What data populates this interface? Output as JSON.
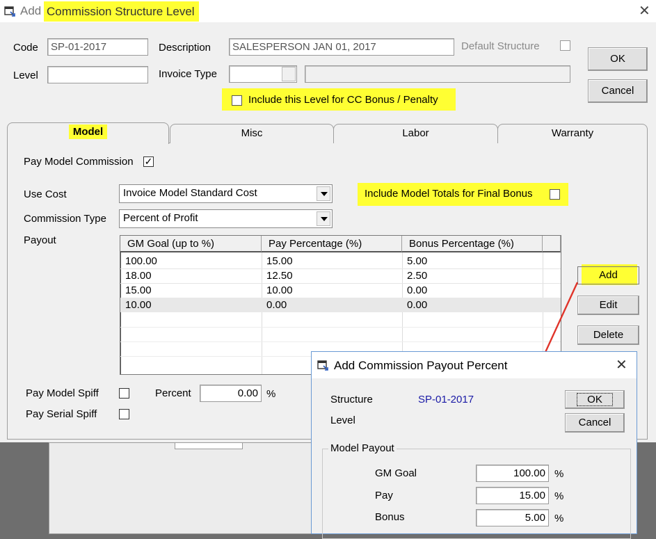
{
  "main_window": {
    "title_prefix": "Add",
    "title": "Commission Structure Level",
    "close_glyph": "✕"
  },
  "header": {
    "code_label": "Code",
    "code_value": "SP-01-2017",
    "description_label": "Description",
    "description_value": "SALESPERSON JAN 01, 2017",
    "default_structure_label": "Default Structure",
    "level_label": "Level",
    "level_value": "",
    "invoice_type_label": "Invoice Type",
    "invoice_type_value": "",
    "invoice_type_desc": "",
    "include_cc_label": "Include this Level for CC Bonus / Penalty",
    "ok_label": "OK",
    "cancel_label": "Cancel"
  },
  "tabs": [
    {
      "label": "Model",
      "active": true
    },
    {
      "label": "Misc",
      "active": false
    },
    {
      "label": "Labor",
      "active": false
    },
    {
      "label": "Warranty",
      "active": false
    }
  ],
  "model_tab": {
    "pay_model_commission_label": "Pay Model Commission",
    "pay_model_commission_checked": "✓",
    "use_cost_label": "Use Cost",
    "use_cost_value": "Invoice Model Standard Cost",
    "include_totals_label": "Include Model Totals for Final Bonus",
    "commission_type_label": "Commission Type",
    "commission_type_value": "Percent of Profit",
    "payout_label": "Payout",
    "payout_columns": [
      "GM Goal (up to %)",
      "Pay Percentage (%)",
      "Bonus Percentage (%)"
    ],
    "payout_rows": [
      [
        "100.00",
        "15.00",
        "5.00"
      ],
      [
        "18.00",
        "12.50",
        "2.50"
      ],
      [
        "15.00",
        "10.00",
        "0.00"
      ],
      [
        "10.00",
        "0.00",
        "0.00"
      ]
    ],
    "add_label": "Add",
    "edit_label": "Edit",
    "delete_label": "Delete",
    "pay_model_spiff_label": "Pay Model Spiff",
    "percent_label": "Percent",
    "percent_value": "0.00",
    "percent_unit": "%",
    "pay_serial_spiff_label": "Pay Serial Spiff"
  },
  "payout_dialog": {
    "title": "Add Commission Payout Percent",
    "close_glyph": "✕",
    "structure_label": "Structure",
    "structure_value": "SP-01-2017",
    "level_label": "Level",
    "ok_label": "OK",
    "cancel_label": "Cancel",
    "group_label": "Model Payout",
    "gm_goal_label": "GM Goal",
    "gm_goal_value": "100.00",
    "pay_label": "Pay",
    "pay_value": "15.00",
    "bonus_label": "Bonus",
    "bonus_value": "5.00",
    "unit": "%"
  },
  "colors": {
    "highlight": "#ffff33",
    "annotation_arrow": "#e0342a",
    "structure_value": "#1a1aa6"
  }
}
